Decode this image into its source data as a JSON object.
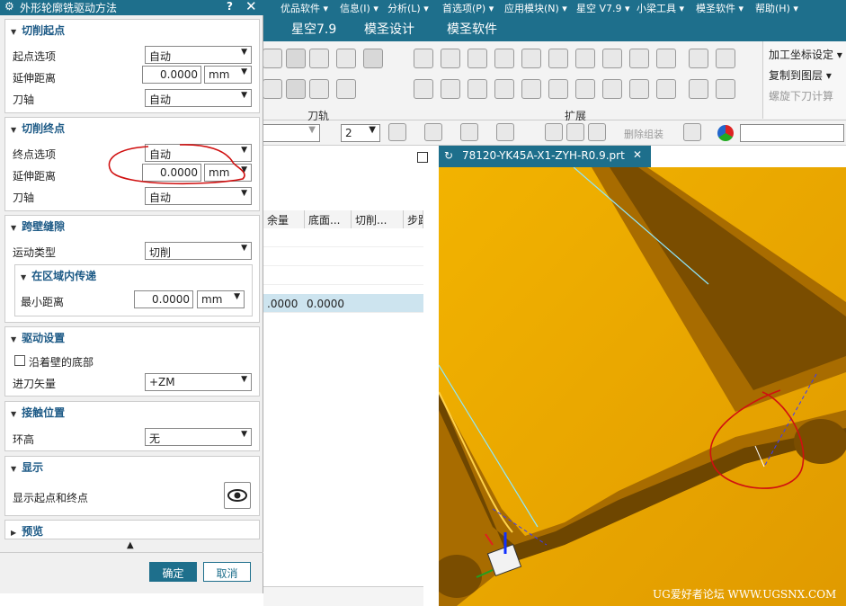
{
  "menubar": {
    "items": [
      "优品软件 ▾",
      "信息(I) ▾",
      "分析(L) ▾",
      "首选项(P) ▾",
      "应用模块(N) ▾",
      "星空 V7.9 ▾",
      "小梁工具 ▾",
      "模圣软件 ▾",
      "帮助(H) ▾"
    ]
  },
  "ribbon_tabs": [
    "星空7.9",
    "模圣设计",
    "模圣软件"
  ],
  "ribbon": {
    "group_toolpath": "刀轨",
    "group_extend": "扩展",
    "right_items": [
      "加工坐标设定 ▾",
      "复制到图层 ▾",
      "螺旋下刀计算"
    ]
  },
  "toolbar2": {
    "layer_value": "2",
    "delete_group_label": "删除组装"
  },
  "dialog": {
    "title": "外形轮廓铣驱动方法",
    "help": "?",
    "close": "✕",
    "cut_start": {
      "title": "切削起点",
      "start_option_label": "起点选项",
      "start_option_value": "自动",
      "extend_label": "延伸距离",
      "extend_value": "0.0000",
      "unit": "mm",
      "tool_axis_label": "刀轴",
      "tool_axis_value": "自动"
    },
    "cut_end": {
      "title": "切削终点",
      "end_option_label": "终点选项",
      "end_option_value": "自动",
      "extend_label": "延伸距离",
      "extend_value": "0.0000",
      "unit": "mm",
      "tool_axis_label": "刀轴",
      "tool_axis_value": "自动"
    },
    "gap": {
      "title": "跨壁缝隙",
      "motion_label": "运动类型",
      "motion_value": "切削",
      "sub_title": "在区域内传递",
      "min_dist_label": "最小距离",
      "min_dist_value": "0.0000",
      "unit": "mm"
    },
    "drive": {
      "title": "驱动设置",
      "along_wall_label": "沿着壁的底部",
      "feed_vector_label": "进刀矢量",
      "feed_vector_value": "+ZM"
    },
    "contact": {
      "title": "接触位置",
      "ring_label": "环高",
      "ring_value": "无"
    },
    "display": {
      "title": "显示",
      "show_points_label": "显示起点和终点"
    },
    "preview": {
      "title": "预览"
    },
    "ok": "确定",
    "cancel": "取消"
  },
  "grid": {
    "headers": [
      "余量",
      "底面...",
      "切削...",
      "步距"
    ],
    "row_values": [
      ".0000",
      "0.0000"
    ]
  },
  "viewport": {
    "tab_title": "78120-YK45A-X1-ZYH-R0.9.prt",
    "watermark": "UG爱好者论坛 WWW.UGSNX.COM"
  },
  "colors": {
    "accent": "#1e6f8c",
    "part": "#e8a300",
    "annotation": "#d01010"
  }
}
